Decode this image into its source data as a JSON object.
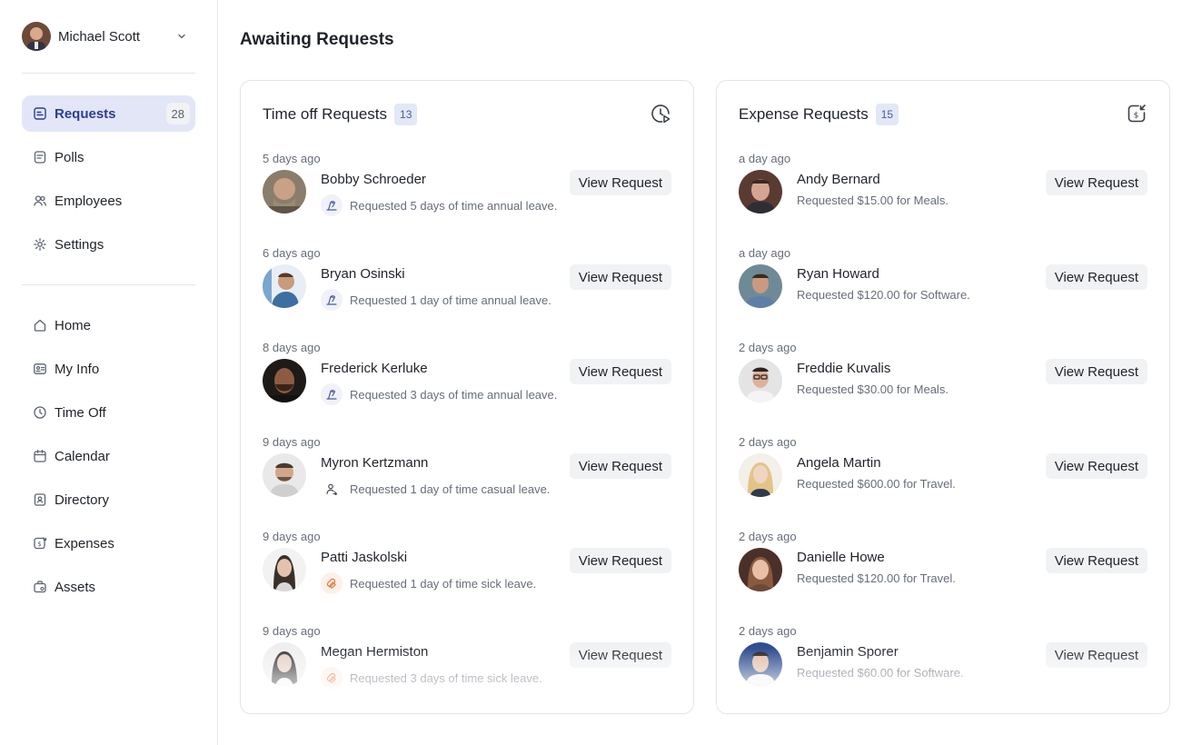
{
  "user": {
    "name": "Michael Scott"
  },
  "sidebar": {
    "primary": [
      {
        "label": "Requests",
        "icon": "requests-icon",
        "count": "28",
        "active": true
      },
      {
        "label": "Polls",
        "icon": "polls-icon"
      },
      {
        "label": "Employees",
        "icon": "employees-icon"
      },
      {
        "label": "Settings",
        "icon": "gear-icon"
      }
    ],
    "secondary": [
      {
        "label": "Home",
        "icon": "home-icon"
      },
      {
        "label": "My Info",
        "icon": "id-card-icon"
      },
      {
        "label": "Time Off",
        "icon": "clock-icon"
      },
      {
        "label": "Calendar",
        "icon": "calendar-icon"
      },
      {
        "label": "Directory",
        "icon": "directory-icon"
      },
      {
        "label": "Expenses",
        "icon": "expense-icon"
      },
      {
        "label": "Assets",
        "icon": "briefcase-icon"
      }
    ]
  },
  "main": {
    "title": "Awaiting Requests",
    "timeoff": {
      "title": "Time off Requests",
      "count": "13",
      "icon": "clock-play-icon",
      "items": [
        {
          "when": "5 days ago",
          "name": "Bobby Schroeder",
          "desc": "Requested 5 days of time annual leave.",
          "type": "annual",
          "button": "View Request"
        },
        {
          "when": "6 days ago",
          "name": "Bryan Osinski",
          "desc": "Requested 1 day of time annual leave.",
          "type": "annual",
          "button": "View Request"
        },
        {
          "when": "8 days ago",
          "name": "Frederick Kerluke",
          "desc": "Requested 3 days of time annual leave.",
          "type": "annual",
          "button": "View Request"
        },
        {
          "when": "9 days ago",
          "name": "Myron Kertzmann",
          "desc": "Requested 1 day of time casual leave.",
          "type": "casual",
          "button": "View Request"
        },
        {
          "when": "9 days ago",
          "name": "Patti Jaskolski",
          "desc": "Requested 1 day of time sick leave.",
          "type": "sick",
          "button": "View Request"
        },
        {
          "when": "9 days ago",
          "name": "Megan Hermiston",
          "desc": "Requested 3 days of time sick leave.",
          "type": "sick",
          "button": "View Request"
        }
      ]
    },
    "expense": {
      "title": "Expense Requests",
      "count": "15",
      "icon": "expense-download-icon",
      "items": [
        {
          "when": "a day ago",
          "name": "Andy Bernard",
          "desc": "Requested $15.00 for Meals.",
          "button": "View Request"
        },
        {
          "when": "a day ago",
          "name": "Ryan Howard",
          "desc": "Requested $120.00 for Software.",
          "button": "View Request"
        },
        {
          "when": "2 days ago",
          "name": "Freddie Kuvalis",
          "desc": "Requested $30.00 for Meals.",
          "button": "View Request"
        },
        {
          "when": "2 days ago",
          "name": "Angela Martin",
          "desc": "Requested $600.00 for Travel.",
          "button": "View Request"
        },
        {
          "when": "2 days ago",
          "name": "Danielle Howe",
          "desc": "Requested $120.00 for Travel.",
          "button": "View Request"
        },
        {
          "when": "2 days ago",
          "name": "Benjamin Sporer",
          "desc": "Requested $60.00 for Software.",
          "button": "View Request"
        }
      ]
    }
  },
  "colors": {
    "accent": "#2d3d95",
    "active_bg": "#e2e6f7",
    "badge_bg": "#e3e8f6",
    "sick": "#e07a3f"
  }
}
